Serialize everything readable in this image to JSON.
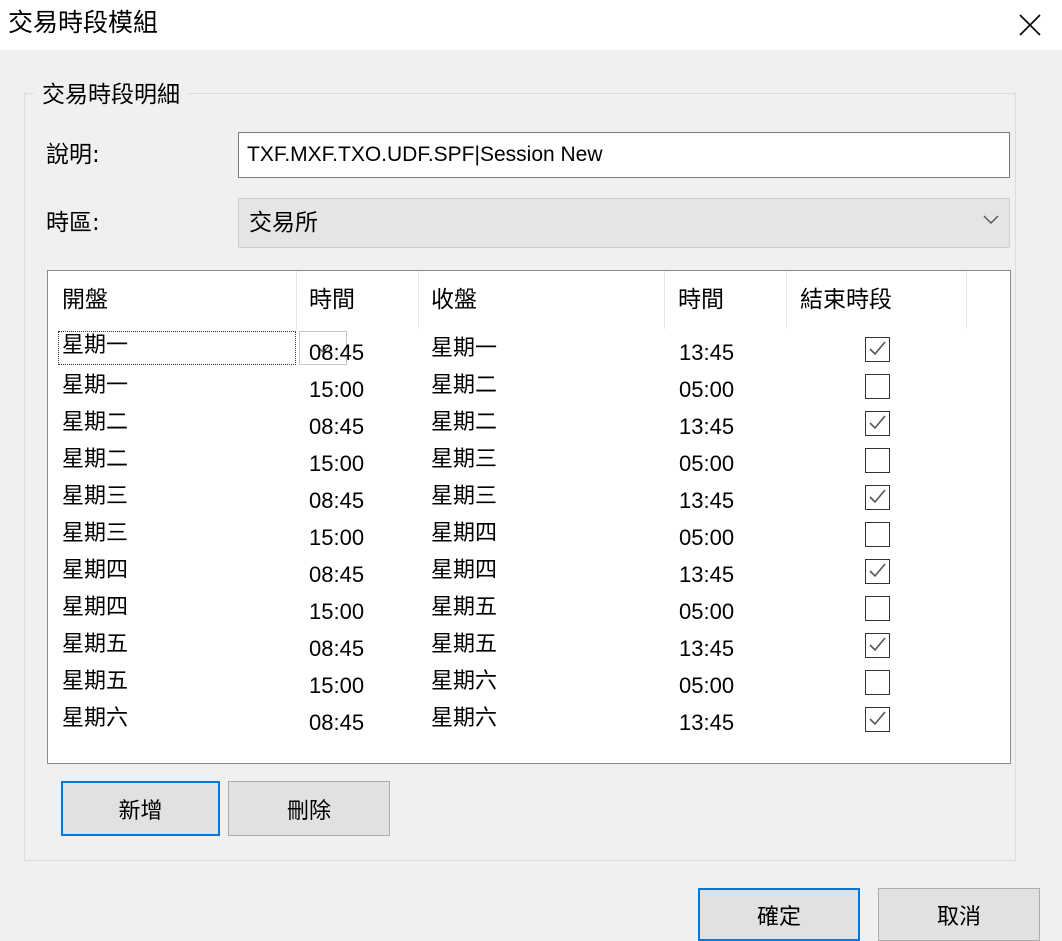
{
  "window": {
    "title": "交易時段模組"
  },
  "group": {
    "title": "交易時段明細"
  },
  "description": {
    "label": "說明:",
    "value": "TXF.MXF.TXO.UDF.SPF|Session New"
  },
  "timezone": {
    "label": "時區:",
    "value": "交易所"
  },
  "table": {
    "headers": [
      "開盤",
      "時間",
      "收盤",
      "時間",
      "結束時段"
    ],
    "rows": [
      {
        "open_day": "星期一",
        "open_time": "08:45",
        "close_day": "星期一",
        "close_time": "13:45",
        "end_session": true
      },
      {
        "open_day": "星期一",
        "open_time": "15:00",
        "close_day": "星期二",
        "close_time": "05:00",
        "end_session": false
      },
      {
        "open_day": "星期二",
        "open_time": "08:45",
        "close_day": "星期二",
        "close_time": "13:45",
        "end_session": true
      },
      {
        "open_day": "星期二",
        "open_time": "15:00",
        "close_day": "星期三",
        "close_time": "05:00",
        "end_session": false
      },
      {
        "open_day": "星期三",
        "open_time": "08:45",
        "close_day": "星期三",
        "close_time": "13:45",
        "end_session": true
      },
      {
        "open_day": "星期三",
        "open_time": "15:00",
        "close_day": "星期四",
        "close_time": "05:00",
        "end_session": false
      },
      {
        "open_day": "星期四",
        "open_time": "08:45",
        "close_day": "星期四",
        "close_time": "13:45",
        "end_session": true
      },
      {
        "open_day": "星期四",
        "open_time": "15:00",
        "close_day": "星期五",
        "close_time": "05:00",
        "end_session": false
      },
      {
        "open_day": "星期五",
        "open_time": "08:45",
        "close_day": "星期五",
        "close_time": "13:45",
        "end_session": true
      },
      {
        "open_day": "星期五",
        "open_time": "15:00",
        "close_day": "星期六",
        "close_time": "05:00",
        "end_session": false
      },
      {
        "open_day": "星期六",
        "open_time": "08:45",
        "close_day": "星期六",
        "close_time": "13:45",
        "end_session": true
      }
    ]
  },
  "buttons": {
    "add": "新增",
    "delete": "刪除",
    "ok": "確定",
    "cancel": "取消"
  },
  "icons": {
    "close": "close-icon",
    "dropdown": "chevron-down-icon",
    "check": "check-icon"
  },
  "colors": {
    "default_button_border": "#0078d7",
    "window_bg": "#f0f0f0"
  }
}
